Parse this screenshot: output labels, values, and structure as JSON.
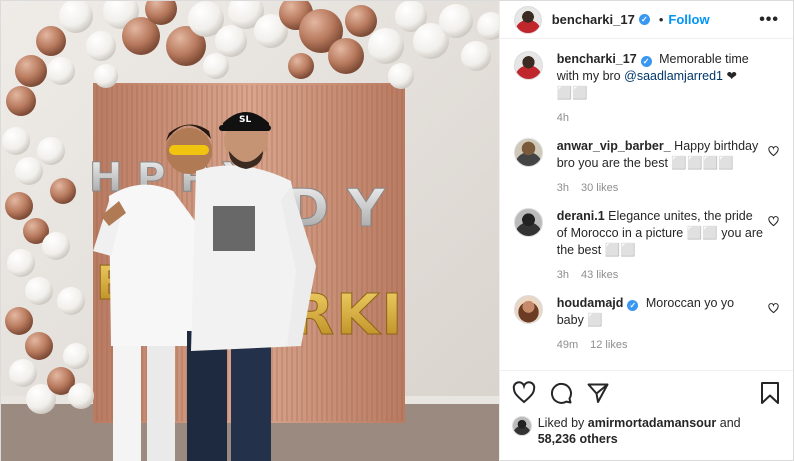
{
  "header": {
    "username": "bencharki_17",
    "verified_mark": "✓",
    "separator": "•",
    "follow_label": "Follow",
    "more_label": "•••"
  },
  "caption": {
    "username": "bencharki_17",
    "text": "Memorable time with my bro ",
    "mention": "@saadlamjarred1",
    "suffix": " ❤⬜⬜",
    "time": "4h"
  },
  "comments": [
    {
      "username": "anwar_vip_barber_",
      "text": "Happy birthday bro you are the best ⬜⬜⬜⬜",
      "time": "3h",
      "likes": "30 likes",
      "verified": false
    },
    {
      "username": "derani.1",
      "text": "Elegance unites, the pride of Morocco in a picture ⬜⬜ you are the best ⬜⬜",
      "time": "3h",
      "likes": "43 likes",
      "verified": false
    },
    {
      "username": "houdamajd",
      "text": "Moroccan yo yo baby ⬜",
      "time": "49m",
      "likes": "12 likes",
      "verified": true
    }
  ],
  "actions": {
    "icons": [
      "heart-icon",
      "comment-icon",
      "share-icon",
      "bookmark-icon"
    ]
  },
  "liked_by": {
    "prefix": "Liked by ",
    "user": "amirmortadamansour",
    "mid": " and",
    "count": "58,236 others"
  },
  "photo": {
    "banner_left": "H P P Y",
    "banner_gold": "B",
    "banner_gold_right": "RKI",
    "banner_silver_right": "D Y",
    "cap_logo": "SL"
  },
  "colors": {
    "accent": "#0095f6",
    "verified": "#3897f0",
    "muted": "#8e8e8e",
    "balloon_bronze": "#b87a5e",
    "balloon_white": "#f3f1ee",
    "curtain": "#c69078",
    "gold": "#d9a82a"
  }
}
